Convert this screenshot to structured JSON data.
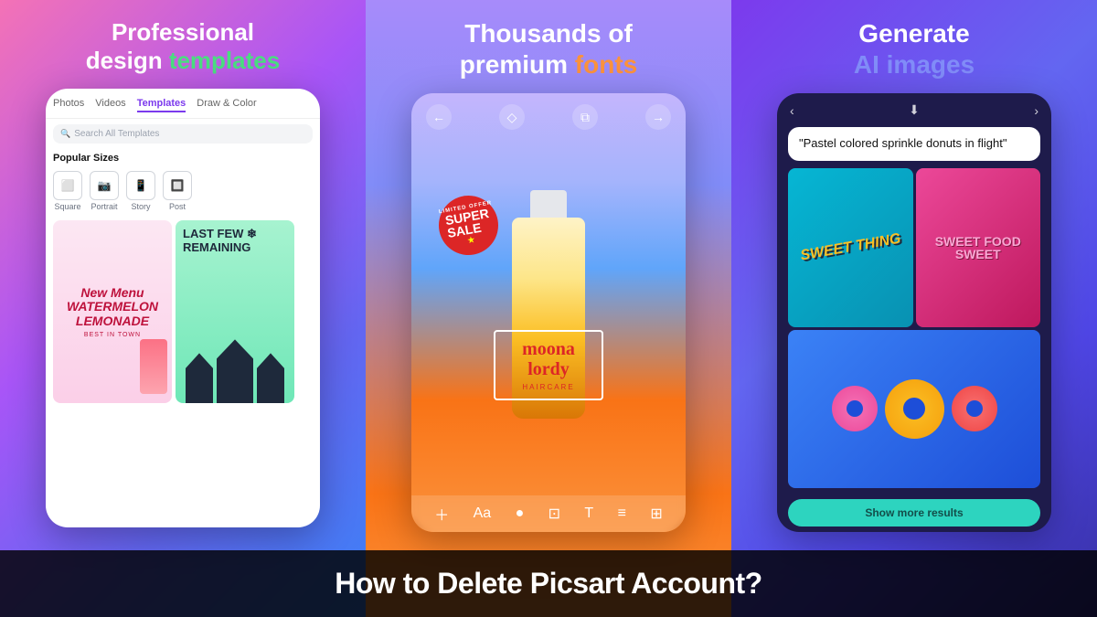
{
  "panels": [
    {
      "id": "panel-1",
      "heading_line1": "Professional",
      "heading_line2": "design ",
      "heading_highlight": "templates",
      "phone": {
        "nav_tabs": [
          "Photos",
          "Videos",
          "Templates",
          "Draw & Color"
        ],
        "active_tab": "Templates",
        "search_placeholder": "Search All Templates",
        "popular_sizes_label": "Popular Sizes",
        "sizes": [
          {
            "icon": "⬜",
            "label": "Square"
          },
          {
            "icon": "📱",
            "label": "Portrait"
          },
          {
            "icon": "📖",
            "label": "Story"
          },
          {
            "icon": "🔲",
            "label": "Post"
          }
        ],
        "templates": [
          {
            "title": "New Menu\nWATERMELON\nLEMONADE",
            "subtitle": "BEST IN TOWN",
            "bg": "pink"
          },
          {
            "title": "LAST FEW ❄\nREMAINING",
            "bg": "teal"
          }
        ]
      }
    },
    {
      "id": "panel-2",
      "heading_line1": "Thousands of",
      "heading_line2": "premium ",
      "heading_highlight": "fonts",
      "phone": {
        "sale_badge_small": "LIMITED OFFER",
        "sale_badge_main": "SUPER\nSALE",
        "bottle_brand": "moona\nlordy",
        "bottle_sub": "HAIRCARE"
      }
    },
    {
      "id": "panel-3",
      "heading_line1": "Generate",
      "heading_highlight": "AI images",
      "phone": {
        "prompt": "\"Pastel colored sprinkle donuts in flight\"",
        "ai_text_1": "SWEET\nTHING",
        "ai_text_2": "SWEET\nFOOD\nSWEET",
        "show_more_label": "Show more results"
      }
    }
  ],
  "bottom_banner": {
    "text": "How to Delete Picsart Account?"
  }
}
